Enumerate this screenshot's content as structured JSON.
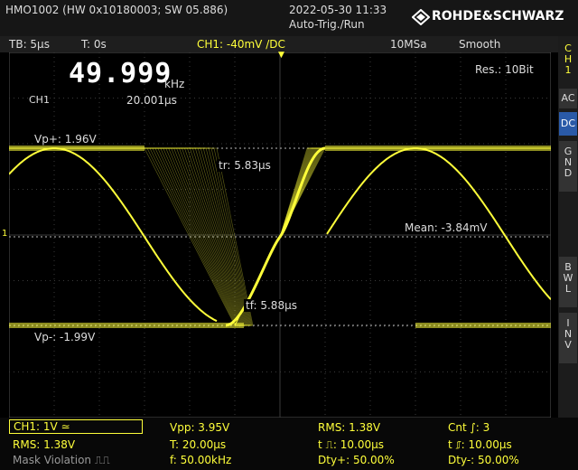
{
  "status": {
    "device": "HMO1002 (HW 0x10180003; SW 05.886)",
    "datetime": "2022-05-30 11:33",
    "trigger_state": "Auto-Trig./Run",
    "brand": "ROHDE&SCHWARZ"
  },
  "info": {
    "timebase": "TB: 5µs",
    "time_offset": "T: 0s",
    "channel_setting": "CH1: -40mV /DC",
    "sample_rate": "10MSa",
    "mode": "Smooth"
  },
  "sidebar": {
    "channel_label": [
      "C",
      "H",
      "1"
    ],
    "coupling_ac": "AC",
    "coupling_dc": "DC",
    "coupling_gnd": [
      "G",
      "N",
      "D"
    ],
    "bwl": [
      "B",
      "W",
      "L"
    ],
    "inv": [
      "I",
      "N",
      "V"
    ]
  },
  "screen": {
    "frequency": "49.999",
    "frequency_unit": "kHz",
    "channel_tag": "CH1",
    "period": "20.001µs",
    "resolution": "Res.: 10Bit",
    "vp_plus": "Vp+: 1.96V",
    "vp_minus": "Vp-: -1.99V",
    "rise_time": "tr: 5.83µs",
    "fall_time": "tf: 5.88µs",
    "mean": "Mean: -3.84mV",
    "marker_1": "1"
  },
  "measurements": {
    "ch1_scale": "CH1: 1V ≃",
    "rms_1": "RMS: 1.38V",
    "mask_violation": "Mask Violation ⎍⎍",
    "vpp": "Vpp: 3.95V",
    "period": "T: 20.00µs",
    "freq": "f: 50.00kHz",
    "rms_2": "RMS: 1.38V",
    "pulse_pos": "t ⎍: 10.00µs",
    "duty_pos": "Dty+: 50.00%",
    "count": "Cnt ∫: 3",
    "pulse_neg": "t ⎎: 10.00µs",
    "duty_neg": "Dty-: 50.00%"
  },
  "colors": {
    "trace": "#ffff3a",
    "active_button": "#2a5aa8",
    "background": "#000000"
  }
}
